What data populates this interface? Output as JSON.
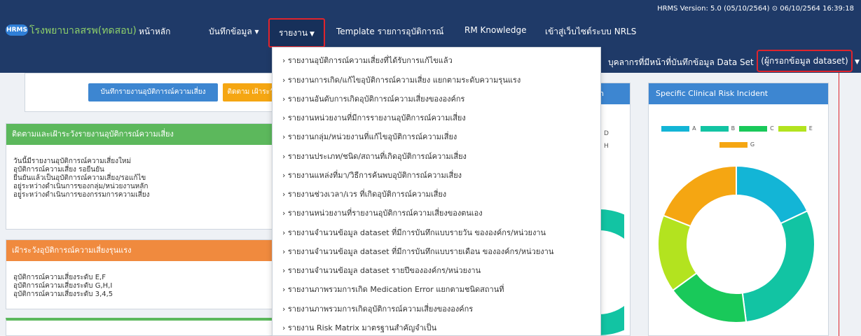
{
  "header": {
    "version": "HRMS Version: 5.0 (05/10/2564) ⊙ 06/10/2564 16:39:18",
    "logo": "HRMS",
    "hospital": "โรงพยาบาลสรพ(ทดสอบ)",
    "nav": {
      "home": "หน้าหลัก",
      "record": "บันทึกข้อมูล ▾",
      "report": "รายงาน",
      "template": "Template รายการอุบัติการณ์",
      "rm_knowledge": "RM Knowledge",
      "nrls": "เข้าสู่เว็บไซต์ระบบ NRLS"
    },
    "dataset_prefix": "บุคลากรที่มีหน้าที่บันทึกข้อมูล Data Set",
    "dataset_role": "(ผู้กรอกข้อมูล dataset)"
  },
  "buttons": {
    "record_incident": "บันทึกรายงานอุบัติการณ์ความเสี่ยง",
    "follow": "ติดตาม เฝ้าระวัง"
  },
  "panel_follow": {
    "title": "ติดตามและเฝ้าระวังรายงานอุบัติการณ์ความเสี่ยง",
    "lines": [
      "วันนี้มีรายงานอุบัติการณ์ความเสี่ยงใหม่",
      "อุบัติการณ์ความเสี่ยง รอยืนยัน",
      "ยืนยันแล้วเป็นอุบัติการณ์ความเสี่ยง/รอแก้ไข",
      "อยู่ระหว่างดำเนินการของกลุ่ม/หน่วยงานหลัก",
      "อยู่ระหว่างดำเนินการของกรรมการความเสี่ยง"
    ]
  },
  "panel_severe": {
    "title": "เฝ้าระวังอุบัติการณ์ความเสี่ยงรุนแรง",
    "lines": [
      "อุบัติการณ์ความเสี่ยงระดับ E,F",
      "อุบัติการณ์ความเสี่ยงระดับ G,H,I",
      "อุบัติการณ์ความเสี่ยงระดับ 3,4,5"
    ]
  },
  "middle_chart": {
    "title_tail": "n",
    "legend_d": "D",
    "legend_h": "H"
  },
  "report_menu": {
    "items": [
      "› รายงานอุบัติการณ์ความเสี่ยงที่ได้รับการแก้ไขแล้ว",
      "› รายงานการเกิด/แก้ไขอุบัติการณ์ความเสี่ยง แยกตามระดับความรุนแรง",
      "› รายงานอันดับการเกิดอุบัติการณ์ความเสี่ยงขององค์กร",
      "› รายงานหน่วยงานที่มีการรายงานอุบัติการณ์ความเสี่ยง",
      "› รายงานกลุ่ม/หน่วยงานที่แก้ไขอุบัติการณ์ความเสี่ยง",
      "› รายงานประเภท/ชนิด/สถานที่เกิดอุบัติการณ์ความเสี่ยง",
      "› รายงานแหล่งที่มา/วิธีการค้นพบอุบัติการณ์ความเสี่ยง",
      "› รายงานช่วงเวลา/เวร ที่เกิดอุบัติการณ์ความเสี่ยง",
      "› รายงานหน่วยงานที่รายงานอุบัติการณ์ความเสี่ยงของตนเอง",
      "› รายงานจำนวนข้อมูล dataset ที่มีการบันทึกแบบรายวัน ขององค์กร/หน่วยงาน",
      "› รายงานจำนวนข้อมูล dataset ที่มีการบันทึกแบบรายเดือน ขององค์กร/หน่วยงาน",
      "› รายงานจำนวนข้อมูล dataset รายปีขององค์กร/หน่วยงาน",
      "› รายงานภาพรวมการเกิด Medication Error แยกตามชนิดสถานที่",
      "› รายงานภาพรวมการเกิดอุบัติการณ์ความเสี่ยงขององค์กร",
      "› รายงาน Risk Matrix มาตรฐานสำคัญจำเป็น"
    ]
  },
  "chart_data": {
    "type": "pie",
    "title": "Specific Clinical Risk Incident",
    "categories": [
      "A",
      "B",
      "C",
      "E",
      "G"
    ],
    "values": [
      18,
      30,
      17,
      16,
      19
    ],
    "colors": [
      "#13b5d6",
      "#12c4a3",
      "#19c95a",
      "#b3e31f",
      "#f5a612"
    ],
    "legend": "top"
  }
}
